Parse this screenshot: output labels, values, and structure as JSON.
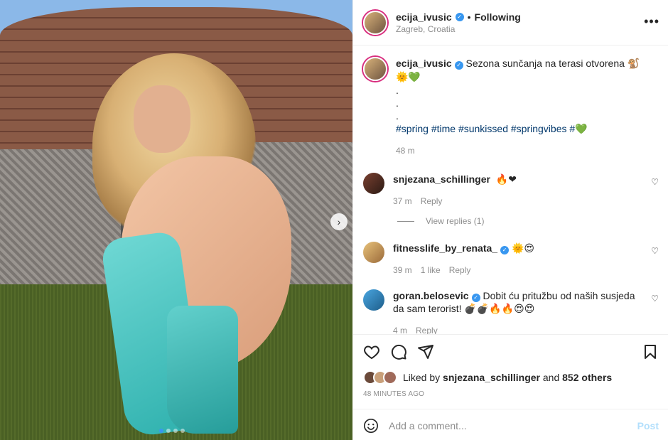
{
  "post": {
    "carousel_next_icon": "chevron-right-icon",
    "dots_count": 4,
    "active_dot": 0
  },
  "header": {
    "username": "ecija_ivusic",
    "separator": "•",
    "follow_status": "Following",
    "location": "Zagreb, Croatia",
    "more_icon": "more-options-icon"
  },
  "caption": {
    "username": "ecija_ivusic",
    "text": "Sezona sunčanja na terasi otvorena",
    "emojis": "🐒🌞💚",
    "dots": [
      ".",
      ".",
      "."
    ],
    "hashtags": [
      "#spring",
      "#time",
      "#sunkissed",
      "#springvibes",
      "#"
    ],
    "trailing_emoji": "💚",
    "time": "48 m"
  },
  "comments": [
    {
      "username": "snjezana_schillinger",
      "verified": false,
      "text": "",
      "emojis": "🔥❤",
      "time": "37 m",
      "likes": "",
      "reply": "Reply",
      "view_replies": "View replies (1)"
    },
    {
      "username": "fitnesslife_by_renata_",
      "verified": true,
      "text": "",
      "emojis": "🌞😍",
      "time": "39 m",
      "likes": "1 like",
      "reply": "Reply",
      "view_replies": ""
    },
    {
      "username": "goran.belosevic",
      "verified": true,
      "text": "Dobit ću pritužbu od naših susjeda da sam terorist!",
      "emojis": "💣💣🔥🔥😍😍",
      "time": "4 m",
      "likes": "",
      "reply": "Reply",
      "view_replies": ""
    }
  ],
  "actions": {
    "like_icon": "heart-icon",
    "comment_icon": "comment-icon",
    "share_icon": "share-icon",
    "save_icon": "bookmark-icon",
    "liked_by_prefix": "Liked by",
    "liked_by_user": "snjezana_schillinger",
    "liked_by_and": "and",
    "liked_by_others": "852 others",
    "timestamp": "48 MINUTES AGO"
  },
  "add_comment": {
    "emoji_icon": "smiley-icon",
    "placeholder": "Add a comment...",
    "post_label": "Post"
  },
  "colors": {
    "link": "#00376b",
    "verified": "#3897f0",
    "muted": "#8e8e8e",
    "post_disabled": "#b2dffc"
  }
}
